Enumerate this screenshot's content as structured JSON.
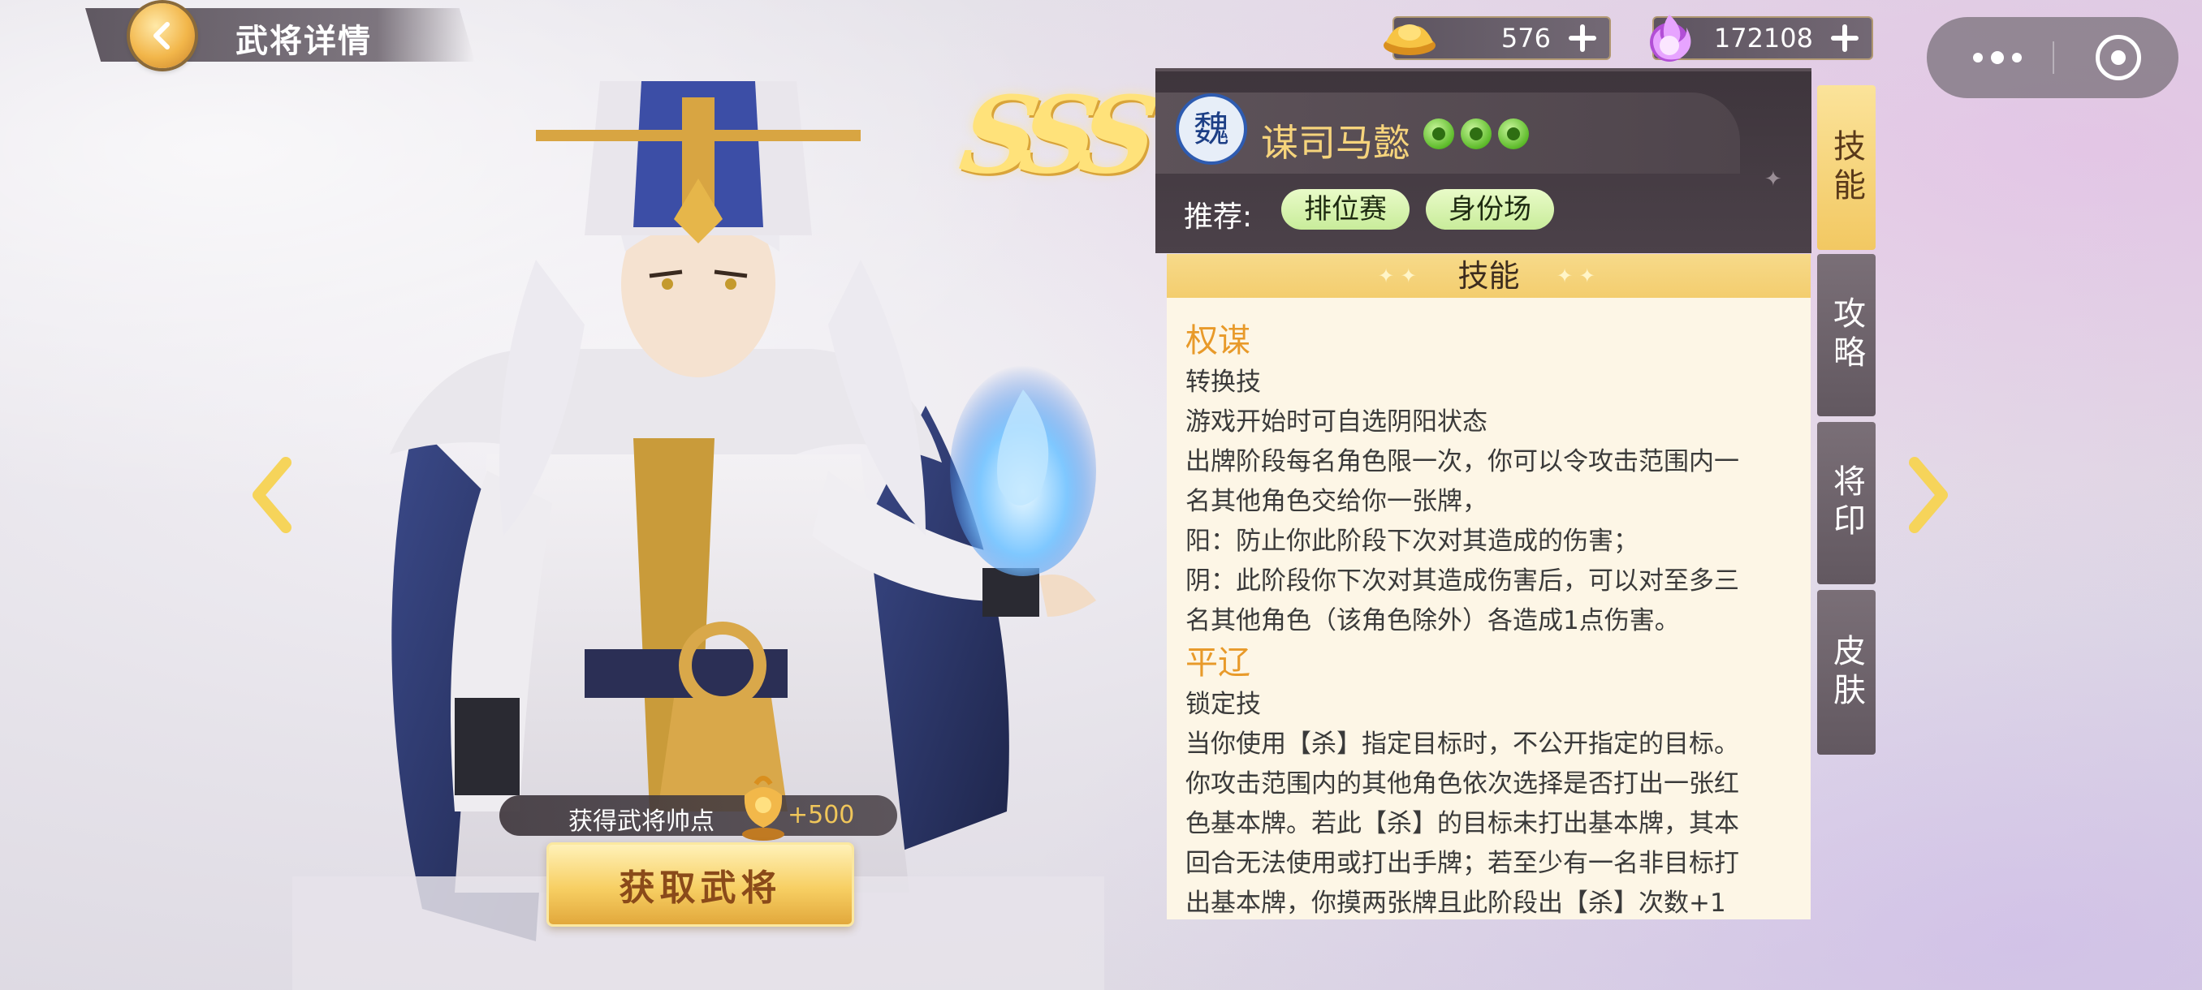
{
  "header": {
    "title": "武将详情"
  },
  "currency": {
    "gold": {
      "icon": "gold-ingot-icon",
      "value": "576"
    },
    "jade": {
      "icon": "purple-flame-icon",
      "value": "172108"
    }
  },
  "hero": {
    "rank": "SSS",
    "kingdom": "魏",
    "name": "谋司马懿",
    "stars": 3,
    "recommend_label": "推荐:",
    "recommend_tags": [
      "排位赛",
      "身份场"
    ],
    "points_label": "获得武将帅点",
    "points_value": "+500",
    "acquire_label": "获取武将"
  },
  "tabs": [
    "技能",
    "攻略",
    "将印",
    "皮肤"
  ],
  "active_tab": "技能",
  "skills_panel": {
    "title": "技能",
    "skills": [
      {
        "name": "权谋",
        "lines": [
          "转换技",
          "游戏开始时可自选阴阳状态",
          "出牌阶段每名角色限一次，你可以令攻击范围内一",
          "名其他角色交给你一张牌，",
          "阳：防止你此阶段下次对其造成的伤害；",
          "阴：此阶段你下次对其造成伤害后，可以对至多三",
          "名其他角色（该角色除外）各造成1点伤害。"
        ]
      },
      {
        "name": "平辽",
        "lines": [
          "锁定技",
          "当你使用【杀】指定目标时，不公开指定的目标。",
          "你攻击范围内的其他角色依次选择是否打出一张红",
          "色基本牌。若此【杀】的目标未打出基本牌，其本",
          "回合无法使用或打出手牌；若至少有一名非目标打",
          "出基本牌，你摸两张牌且此阶段出【杀】次数+1"
        ]
      }
    ]
  },
  "colors": {
    "accent_gold": "#f3cd6e",
    "skill_name": "#e89a2a",
    "tag_green": "#c8ec9a"
  }
}
